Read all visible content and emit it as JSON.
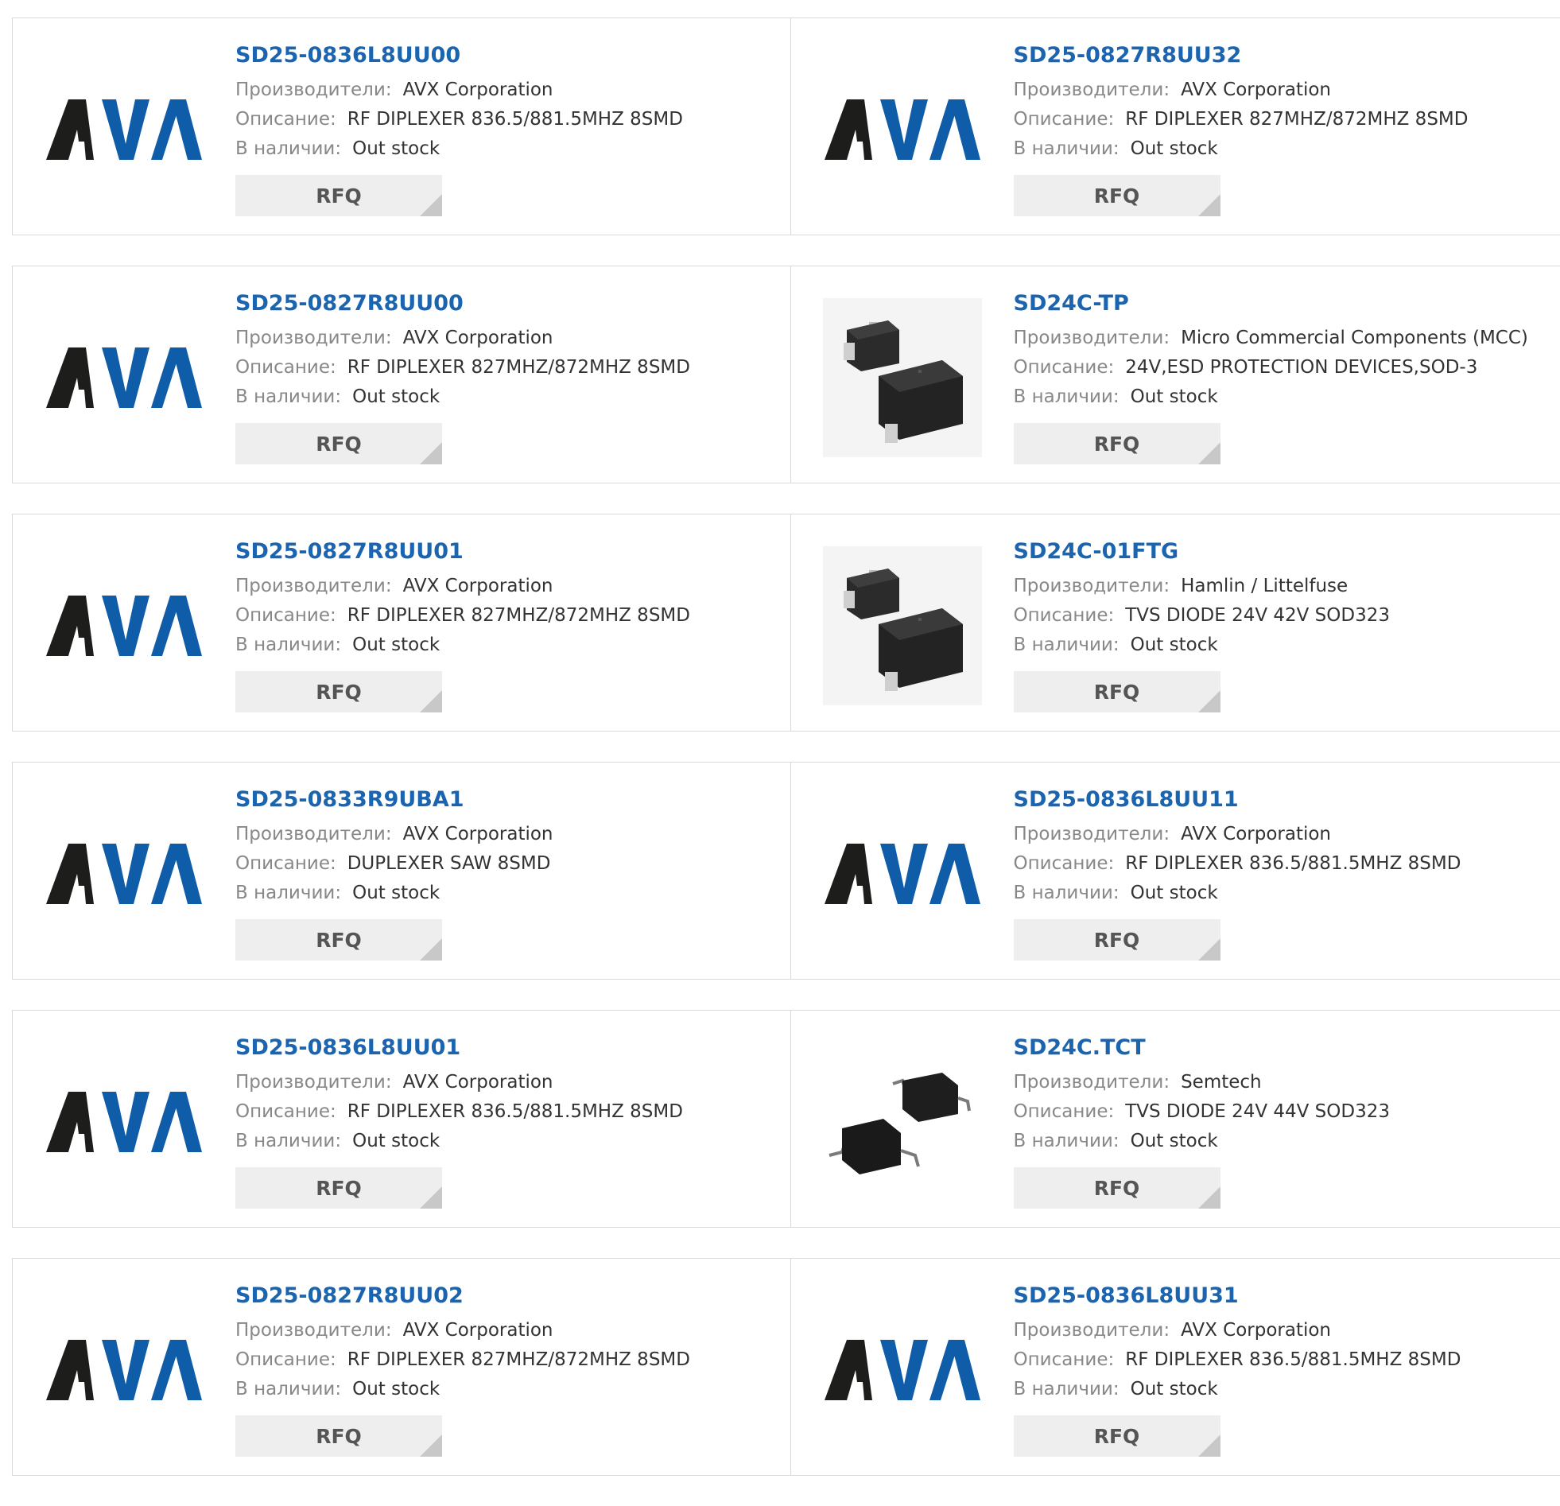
{
  "labels": {
    "manufacturer": "Производители:",
    "description": "Описание:",
    "stock": "В наличии:",
    "rfq": "RFQ"
  },
  "colors": {
    "link": "#1a64b0",
    "logo_dark": "#1d1d1b",
    "logo_blue": "#0f5da8"
  },
  "products": [
    {
      "pn": "SD25-0836L8UU00",
      "mfr": "AVX Corporation",
      "desc": "RF DIPLEXER 836.5/881.5MHZ 8SMD",
      "stock": "Out stock",
      "image": "avx-logo"
    },
    {
      "pn": "SD25-0827R8UU32",
      "mfr": "AVX Corporation",
      "desc": "RF DIPLEXER 827MHZ/872MHZ 8SMD",
      "stock": "Out stock",
      "image": "avx-logo"
    },
    {
      "pn": "SD25-0827R8UU00",
      "mfr": "AVX Corporation",
      "desc": "RF DIPLEXER 827MHZ/872MHZ 8SMD",
      "stock": "Out stock",
      "image": "avx-logo"
    },
    {
      "pn": "SD24C-TP",
      "mfr": "Micro Commercial Components (MCC)",
      "desc": "24V,ESD PROTECTION DEVICES,SOD-3",
      "stock": "Out stock",
      "image": "sod323-photo"
    },
    {
      "pn": "SD25-0827R8UU01",
      "mfr": "AVX Corporation",
      "desc": "RF DIPLEXER 827MHZ/872MHZ 8SMD",
      "stock": "Out stock",
      "image": "avx-logo"
    },
    {
      "pn": "SD24C-01FTG",
      "mfr": "Hamlin / Littelfuse",
      "desc": "TVS DIODE 24V 42V SOD323",
      "stock": "Out stock",
      "image": "sod323-photo"
    },
    {
      "pn": "SD25-0833R9UBA1",
      "mfr": "AVX Corporation",
      "desc": "DUPLEXER SAW 8SMD",
      "stock": "Out stock",
      "image": "avx-logo"
    },
    {
      "pn": "SD25-0836L8UU11",
      "mfr": "AVX Corporation",
      "desc": "RF DIPLEXER 836.5/881.5MHZ 8SMD",
      "stock": "Out stock",
      "image": "avx-logo"
    },
    {
      "pn": "SD25-0836L8UU01",
      "mfr": "AVX Corporation",
      "desc": "RF DIPLEXER 836.5/881.5MHZ 8SMD",
      "stock": "Out stock",
      "image": "avx-logo"
    },
    {
      "pn": "SD24C.TCT",
      "mfr": "Semtech",
      "desc": "TVS DIODE 24V 44V SOD323",
      "stock": "Out stock",
      "image": "sod323-leaded-photo"
    },
    {
      "pn": "SD25-0827R8UU02",
      "mfr": "AVX Corporation",
      "desc": "RF DIPLEXER 827MHZ/872MHZ 8SMD",
      "stock": "Out stock",
      "image": "avx-logo"
    },
    {
      "pn": "SD25-0836L8UU31",
      "mfr": "AVX Corporation",
      "desc": "RF DIPLEXER 836.5/881.5MHZ 8SMD",
      "stock": "Out stock",
      "image": "avx-logo"
    }
  ]
}
